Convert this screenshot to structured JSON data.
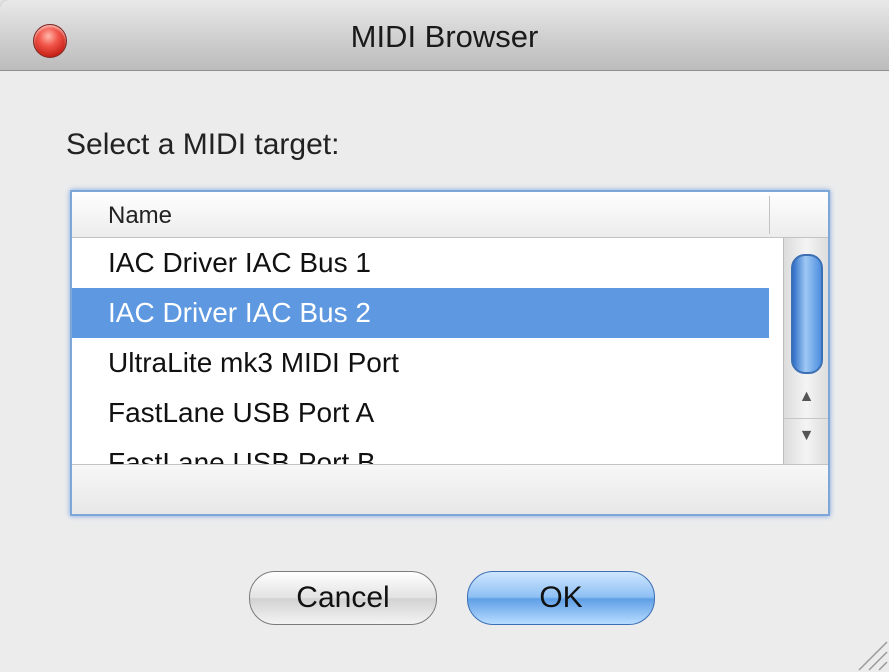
{
  "window": {
    "title": "MIDI Browser"
  },
  "prompt": "Select a MIDI target:",
  "list": {
    "column_header": "Name",
    "items": [
      "IAC Driver IAC Bus 1",
      "IAC Driver IAC Bus 2",
      "UltraLite mk3 MIDI Port",
      "FastLane USB Port A",
      "FastLane USB Port B"
    ],
    "selected_index": 1,
    "selection_color": "#5d98e0"
  },
  "buttons": {
    "cancel_label": "Cancel",
    "ok_label": "OK"
  },
  "icons": {
    "close": "close-icon",
    "scroll_up": "scroll-up-arrow-icon",
    "scroll_down": "scroll-down-arrow-icon",
    "resize": "resize-grip-icon"
  }
}
